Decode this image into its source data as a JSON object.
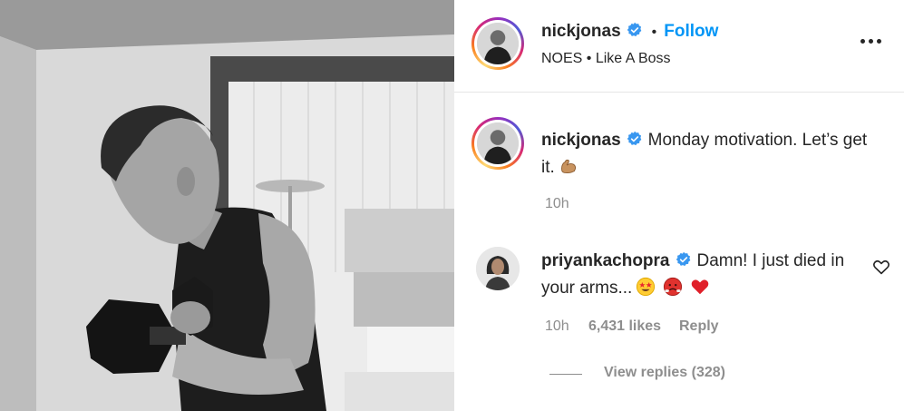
{
  "post": {
    "author": "nickjonas",
    "follow_label": "Follow",
    "separator": "•",
    "location": "NOES • Like A Boss",
    "more_icon": "more-horizontal-icon",
    "caption_text": "Monday motivation. Let’s get it.",
    "caption_emoji": "flexed-biceps",
    "caption_age": "10h"
  },
  "comment": {
    "author": "priyankachopra",
    "text": "Damn! I just died in your arms...",
    "emojis": [
      "star-struck",
      "face-with-steam",
      "red-heart"
    ],
    "age": "10h",
    "likes": "6,431 likes",
    "reply_label": "Reply",
    "view_replies": "View replies (328)"
  },
  "colors": {
    "follow": "#0095f6",
    "verified_badge": "#3897f0",
    "muted_text": "#8e8e8e",
    "primary_text": "#262626"
  }
}
